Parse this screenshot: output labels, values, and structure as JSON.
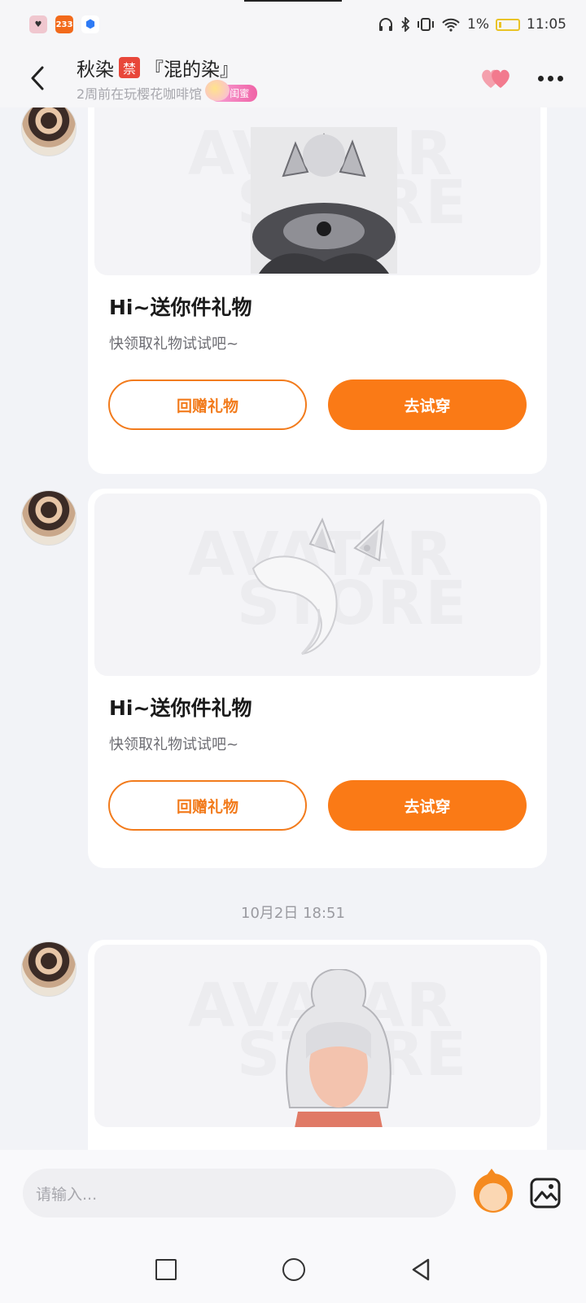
{
  "status_bar": {
    "notif_app_2": "233",
    "battery": "1%",
    "time": "11:05"
  },
  "header": {
    "name": "秋染",
    "ban_badge": "禁",
    "nickname": "『混的染』",
    "subtitle": "2周前在玩樱花咖啡馆",
    "relation_tag": "闺蜜"
  },
  "messages": [
    {
      "type": "gift_card",
      "item_icon": "crown-headpiece",
      "title": "Hi~送你件礼物",
      "desc": "快领取礼物试试吧~",
      "return_button": "回赠礼物",
      "try_button": "去试穿"
    },
    {
      "type": "gift_card",
      "item_icon": "fox-ears-tail",
      "title": "Hi~送你件礼物",
      "desc": "快领取礼物试试吧~",
      "return_button": "回赠礼物",
      "try_button": "去试穿"
    },
    {
      "type": "timestamp",
      "text": "10月2日 18:51"
    },
    {
      "type": "gift_card",
      "item_icon": "white-ponytail-hair"
    }
  ],
  "input": {
    "placeholder": "请输入..."
  },
  "colors": {
    "accent": "#fa7a16",
    "ban": "#e8473a",
    "heart": "#f27a8e"
  }
}
